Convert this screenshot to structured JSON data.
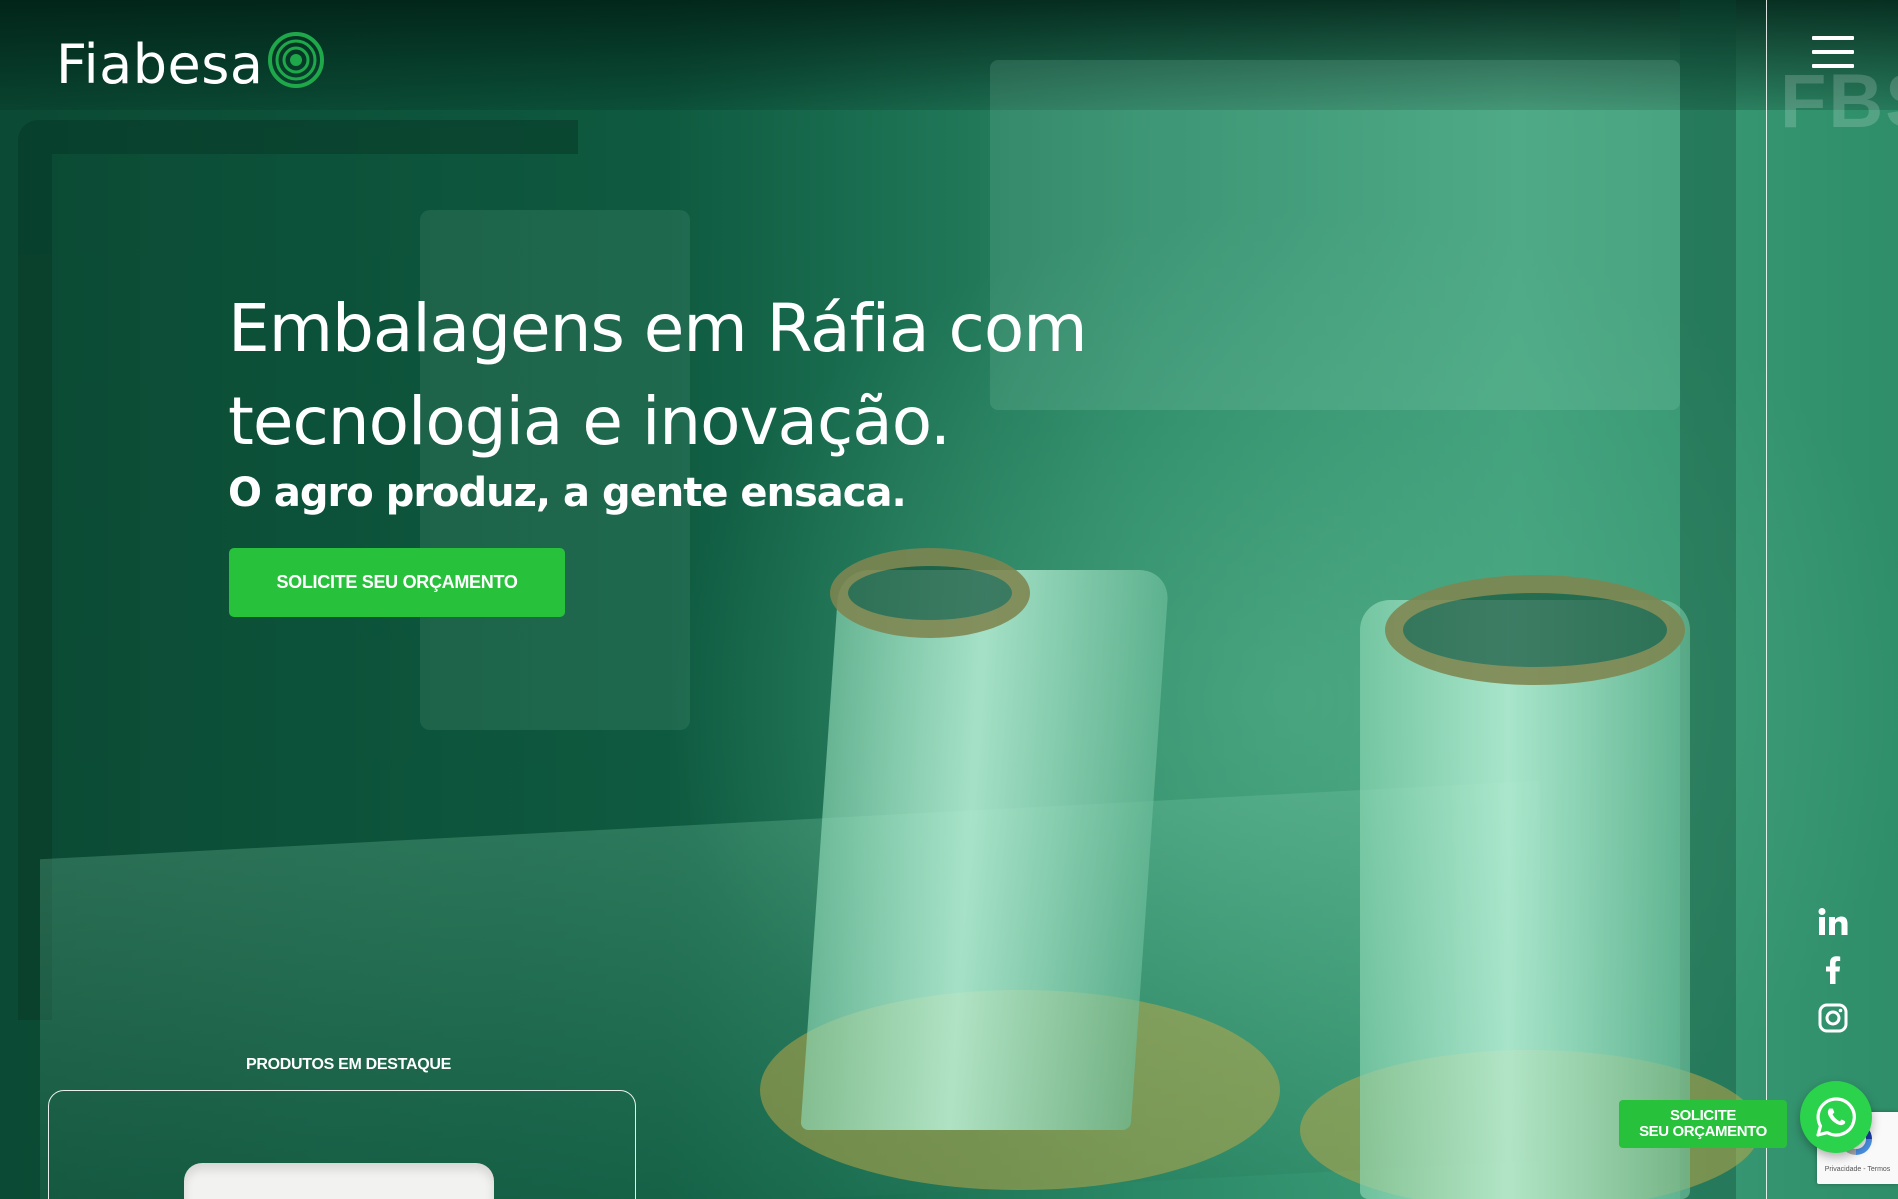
{
  "header": {
    "logo_text": "Fiabesa",
    "watermark_text": "FBS"
  },
  "hero": {
    "headline": "Embalagens em Ráfia com tecnologia e inovação.",
    "subheadline": "O agro produz, a gente ensaca.",
    "cta_label": "SOLICITE SEU ORÇAMENTO"
  },
  "featured": {
    "label": "PRODUTOS EM DESTAQUE"
  },
  "floating": {
    "cta_line1": "SOLICITE",
    "cta_line2": "SEU ORÇAMENTO",
    "recaptcha_text": "Privacidade - Termos"
  },
  "icons": {
    "menu": "hamburger-menu-icon",
    "linkedin": "linkedin-icon",
    "facebook": "facebook-icon",
    "instagram": "instagram-icon",
    "whatsapp": "whatsapp-icon"
  },
  "colors": {
    "accent_green": "#27c13b",
    "hero_overlay": "#0e5a40",
    "whatsapp_green": "#2bd24b",
    "logo_mark": "#1fa84a"
  }
}
